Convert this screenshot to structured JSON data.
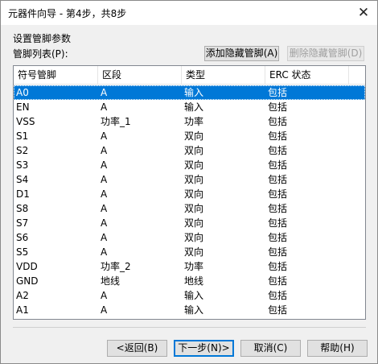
{
  "window": {
    "title": "元器件向导 - 第4步，共8步",
    "close_glyph": "✕"
  },
  "section_heading": "设置管脚参数",
  "pin_list_label": "管脚列表(P):",
  "buttons": {
    "add_hidden": "添加隐藏管脚(A)",
    "delete_hidden": "删除隐藏管脚(D)",
    "back": "<返回(B)",
    "next": "下一步(N)>",
    "cancel": "取消(C)",
    "help": "帮助(H)"
  },
  "table": {
    "columns": [
      "符号管脚",
      "区段",
      "类型",
      "ERC 状态"
    ],
    "rows": [
      [
        "A0",
        "A",
        "输入",
        "包括"
      ],
      [
        "EN",
        "A",
        "输入",
        "包括"
      ],
      [
        "VSS",
        "功率_1",
        "功率",
        "包括"
      ],
      [
        "S1",
        "A",
        "双向",
        "包括"
      ],
      [
        "S2",
        "A",
        "双向",
        "包括"
      ],
      [
        "S3",
        "A",
        "双向",
        "包括"
      ],
      [
        "S4",
        "A",
        "双向",
        "包括"
      ],
      [
        "D1",
        "A",
        "双向",
        "包括"
      ],
      [
        "S8",
        "A",
        "双向",
        "包括"
      ],
      [
        "S7",
        "A",
        "双向",
        "包括"
      ],
      [
        "S6",
        "A",
        "双向",
        "包括"
      ],
      [
        "S5",
        "A",
        "双向",
        "包括"
      ],
      [
        "VDD",
        "功率_2",
        "功率",
        "包括"
      ],
      [
        "GND",
        "地线",
        "地线",
        "包括"
      ],
      [
        "A2",
        "A",
        "输入",
        "包括"
      ],
      [
        "A1",
        "A",
        "输入",
        "包括"
      ]
    ],
    "selected_row": 0
  }
}
